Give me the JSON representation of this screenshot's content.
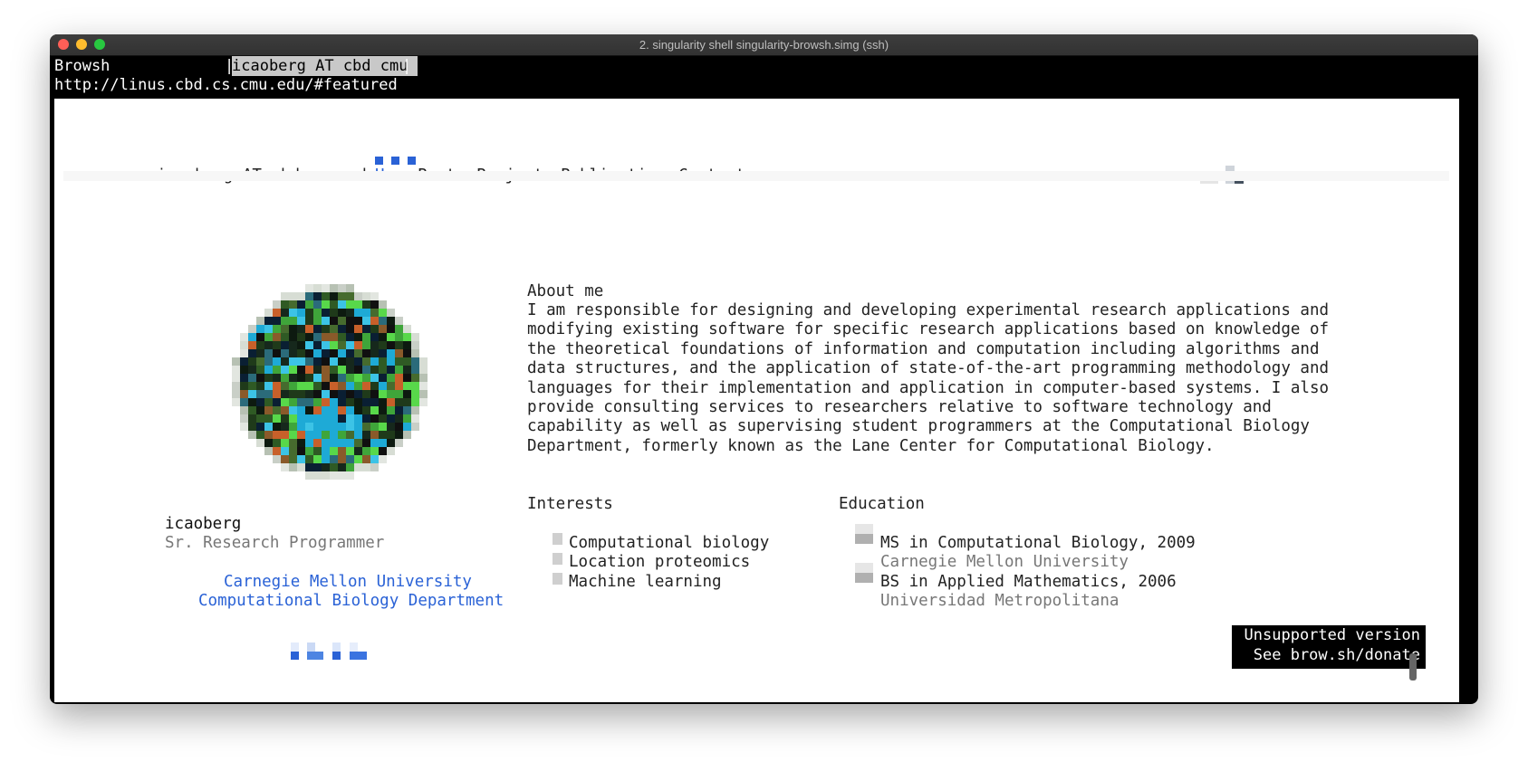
{
  "window": {
    "title": "2. singularity shell singularity-browsh.simg (ssh)",
    "traffic_light_colors": [
      "#ff5f57",
      "#febc2e",
      "#28c840"
    ]
  },
  "browsh": {
    "app_name": "Browsh",
    "tab_label": "icaoberg AT cbd cmu ",
    "url": "http://linus.cbd.cs.cmu.edu/#featured"
  },
  "site": {
    "brand": "icaoberg AT cbd cmu edu",
    "nav": [
      "Home",
      "Posts",
      "Projects",
      "Publications",
      "Contact"
    ],
    "active_nav": "Home"
  },
  "profile": {
    "name": "icaoberg",
    "role": "Sr. Research Programmer",
    "org_line1": "Carnegie Mellon University",
    "org_line2": "Computational Biology Department"
  },
  "about": {
    "heading": "About me",
    "lines": [
      "I am responsible for designing and developing experimental research applications and",
      "modifying existing software for specific research applications based on knowledge of",
      "the theoretical foundations of information and computation including algorithms and",
      "data structures, and the application of state-of-the-art programming methodology and",
      "languages for their implementation and application in computer-based systems. I also",
      "provide consulting services to researchers relative to software technology and",
      "capability as well as supervising student programmers at the Computational Biology",
      "Department, formerly known as the Lane Center for Computational Biology."
    ]
  },
  "interests": {
    "heading": "Interests",
    "items": [
      "Computational biology",
      "Location proteomics",
      "Machine learning"
    ]
  },
  "education": {
    "heading": "Education",
    "items": [
      {
        "degree": "MS in Computational Biology, 2009",
        "school": "Carnegie Mellon University"
      },
      {
        "degree": "BS in Applied Mathematics, 2006",
        "school": "Universidad Metropolitana"
      }
    ]
  },
  "banner": {
    "line1": "Unsupported version",
    "line2": "See brow.sh/donate"
  },
  "colors": {
    "link": "#2a62d6",
    "muted": "#777777",
    "text": "#222222"
  }
}
